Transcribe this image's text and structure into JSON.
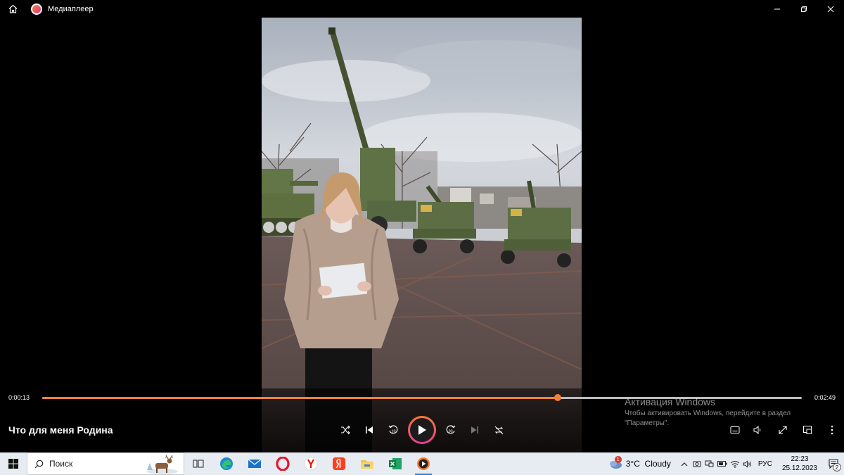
{
  "window": {
    "title": "Медиаплеер"
  },
  "player": {
    "current_time": "0:00:13",
    "total_time": "0:02:49",
    "progress": 0.679,
    "media_title": "Что для меня Родина"
  },
  "watermark": {
    "title": "Активация Windows",
    "text": "Чтобы активировать Windows, перейдите в раздел \"Параметры\"."
  },
  "taskbar": {
    "search_placeholder": "Поиск",
    "weather": "3°C  Cloudy",
    "weather_badge": "1",
    "language": "РУС",
    "time": "22:23",
    "date": "25.12.2023",
    "notification_count": "2",
    "apps": [
      "task-view",
      "edge",
      "mail",
      "opera",
      "yandex-browser",
      "yandex",
      "file-explorer",
      "excel",
      "media-player"
    ]
  },
  "colors": {
    "accent": "#f2823a",
    "accent2": "#e33b93",
    "taskbar": "#e7ecf2"
  }
}
